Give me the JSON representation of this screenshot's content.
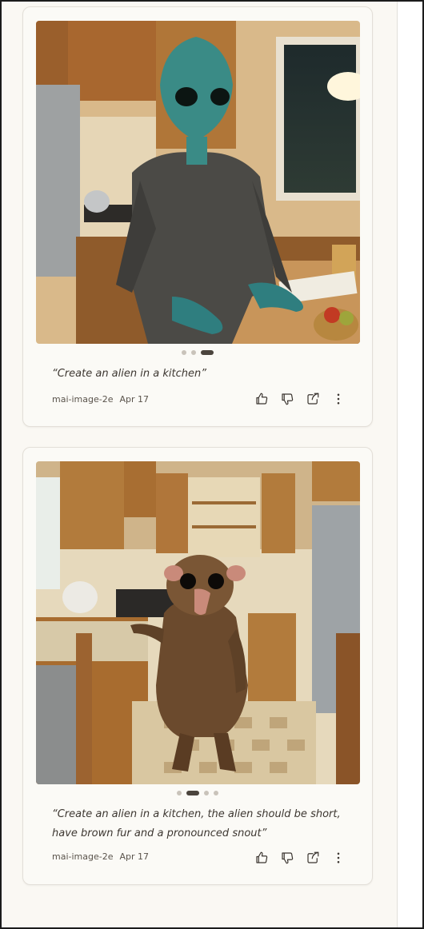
{
  "cards": [
    {
      "image_alt": "Create an alien in a kitchen",
      "prompt": "“Create an alien in a kitchen”",
      "model": "mai-image-2e",
      "date": "Apr 17",
      "carousel_active": 3,
      "carousel_count": 3
    },
    {
      "image_alt": "Create an alien in a kitchen, the alien should be short, have brown fur and a pronounced snout",
      "prompt": "“Create an alien in a kitchen, the alien should be short, have brown fur and a pronounced snout”",
      "model": "mai-image-2e",
      "date": "Apr 17",
      "carousel_active": 2,
      "carousel_count": 4
    }
  ],
  "icons": [
    "thumbs-up-icon",
    "thumbs-down-icon",
    "share-icon",
    "more-icon"
  ],
  "colors": {
    "card_bg": "#fbfaf6",
    "page_bg": "#faf8f3",
    "dot_active": "#4b443d",
    "dot_inactive": "#c9c3ba"
  }
}
